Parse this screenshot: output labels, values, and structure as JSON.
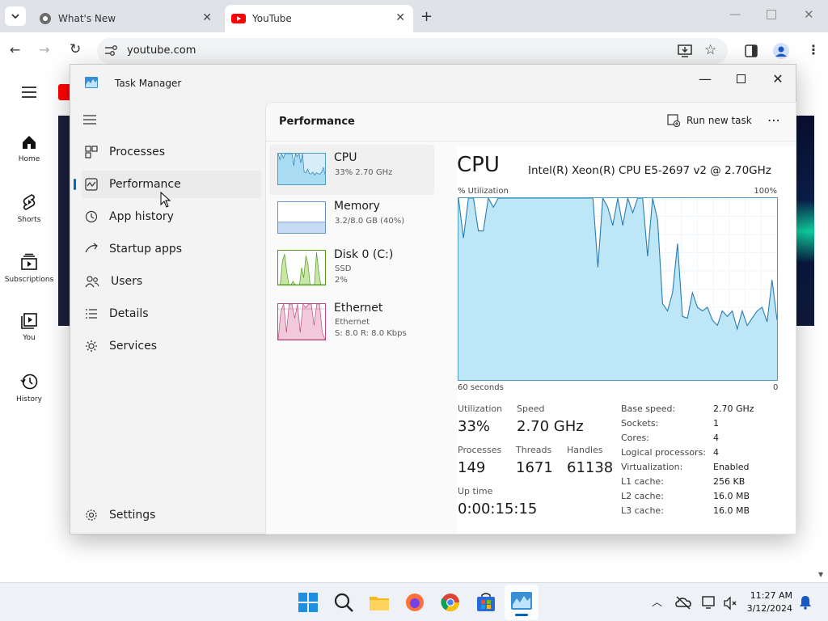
{
  "browser": {
    "tabs": [
      {
        "title": "What's New",
        "active": false
      },
      {
        "title": "YouTube",
        "active": true
      }
    ],
    "url": "youtube.com"
  },
  "youtube": {
    "sidebar": [
      {
        "label": "Home",
        "icon": "home-icon"
      },
      {
        "label": "Shorts",
        "icon": "shorts-icon"
      },
      {
        "label": "Subscriptions",
        "icon": "subscriptions-icon"
      },
      {
        "label": "You",
        "icon": "you-icon"
      },
      {
        "label": "History",
        "icon": "history-icon"
      }
    ]
  },
  "task_manager": {
    "title": "Task Manager",
    "nav": [
      {
        "label": "Processes",
        "icon": "processes-icon"
      },
      {
        "label": "Performance",
        "icon": "performance-icon",
        "selected": true
      },
      {
        "label": "App history",
        "icon": "app-history-icon"
      },
      {
        "label": "Startup apps",
        "icon": "startup-apps-icon"
      },
      {
        "label": "Users",
        "icon": "users-icon"
      },
      {
        "label": "Details",
        "icon": "details-icon"
      },
      {
        "label": "Services",
        "icon": "services-icon"
      }
    ],
    "settings_label": "Settings",
    "header": {
      "title": "Performance",
      "run_new_task": "Run new task",
      "more": "⋯"
    },
    "devices": [
      {
        "name": "CPU",
        "lines": [
          "33%  2.70 GHz"
        ],
        "color": "#4f9cc5",
        "fill": "#d7eef9"
      },
      {
        "name": "Memory",
        "lines": [
          "3.2/8.0 GB (40%)"
        ],
        "color": "#6b91c9",
        "fill": "#dbe8f7"
      },
      {
        "name": "Disk 0 (C:)",
        "lines": [
          "SSD",
          "2%"
        ],
        "color": "#4d9a1b",
        "fill": "#e6f2d6"
      },
      {
        "name": "Ethernet",
        "lines": [
          "Ethernet",
          "S: 8.0  R: 8.0 Kbps"
        ],
        "color": "#b9487c",
        "fill": "#f5dce7"
      }
    ],
    "cpu": {
      "heading": "CPU",
      "model": "Intel(R) Xeon(R) CPU E5-2697 v2 @ 2.70GHz",
      "util_label": "% Utilization",
      "util_max": "100%",
      "x_left": "60 seconds",
      "x_right": "0",
      "stats": {
        "utilization": {
          "label": "Utilization",
          "value": "33%"
        },
        "speed": {
          "label": "Speed",
          "value": "2.70 GHz"
        },
        "processes": {
          "label": "Processes",
          "value": "149"
        },
        "threads": {
          "label": "Threads",
          "value": "1671"
        },
        "handles": {
          "label": "Handles",
          "value": "61138"
        },
        "uptime": {
          "label": "Up time",
          "value": "0:00:15:15"
        }
      },
      "specs": [
        {
          "k": "Base speed:",
          "v": "2.70 GHz"
        },
        {
          "k": "Sockets:",
          "v": "1"
        },
        {
          "k": "Cores:",
          "v": "4"
        },
        {
          "k": "Logical processors:",
          "v": "4"
        },
        {
          "k": "Virtualization:",
          "v": "Enabled"
        },
        {
          "k": "L1 cache:",
          "v": "256 KB"
        },
        {
          "k": "L2 cache:",
          "v": "16.0 MB"
        },
        {
          "k": "L3 cache:",
          "v": "16.0 MB"
        }
      ],
      "history": [
        100,
        78,
        100,
        100,
        82,
        82,
        100,
        95,
        100,
        100,
        100,
        100,
        100,
        100,
        100,
        100,
        100,
        100,
        100,
        100,
        100,
        100,
        100,
        100,
        100,
        100,
        100,
        100,
        100,
        100,
        100,
        100,
        100,
        100,
        100,
        100,
        100,
        100,
        62,
        100,
        100,
        85,
        92,
        100,
        85,
        100,
        92,
        100,
        100,
        68,
        100,
        88,
        70,
        92,
        100,
        94,
        100,
        58,
        40,
        40,
        62,
        75,
        84,
        100,
        100,
        100,
        100,
        100,
        100,
        100,
        95,
        100,
        100,
        100,
        100,
        100,
        100,
        100,
        100,
        100,
        100,
        100,
        100,
        100,
        100,
        100,
        100,
        100,
        100,
        100,
        100,
        100,
        100,
        100,
        100,
        100,
        100,
        100,
        100,
        100,
        100,
        100,
        100,
        100,
        100,
        100,
        100,
        100,
        100,
        100,
        100,
        100,
        100,
        100,
        100,
        100,
        100,
        100,
        100,
        100,
        100,
        100,
        100,
        100,
        100,
        100,
        100,
        100,
        100,
        100,
        100,
        100,
        100,
        100,
        100,
        100,
        100,
        100,
        100,
        100,
        100,
        100,
        100,
        100,
        100,
        100,
        100,
        100,
        100,
        100,
        100,
        100,
        100,
        100,
        100,
        100,
        100,
        100,
        100,
        100,
        100,
        100,
        100,
        100,
        100,
        100,
        100,
        100,
        100,
        100,
        100,
        100,
        100,
        100,
        100,
        100,
        100,
        100,
        100,
        100,
        100,
        100
      ]
    }
  },
  "taskbar": {
    "time": "11:27 AM",
    "date": "3/12/2024"
  }
}
